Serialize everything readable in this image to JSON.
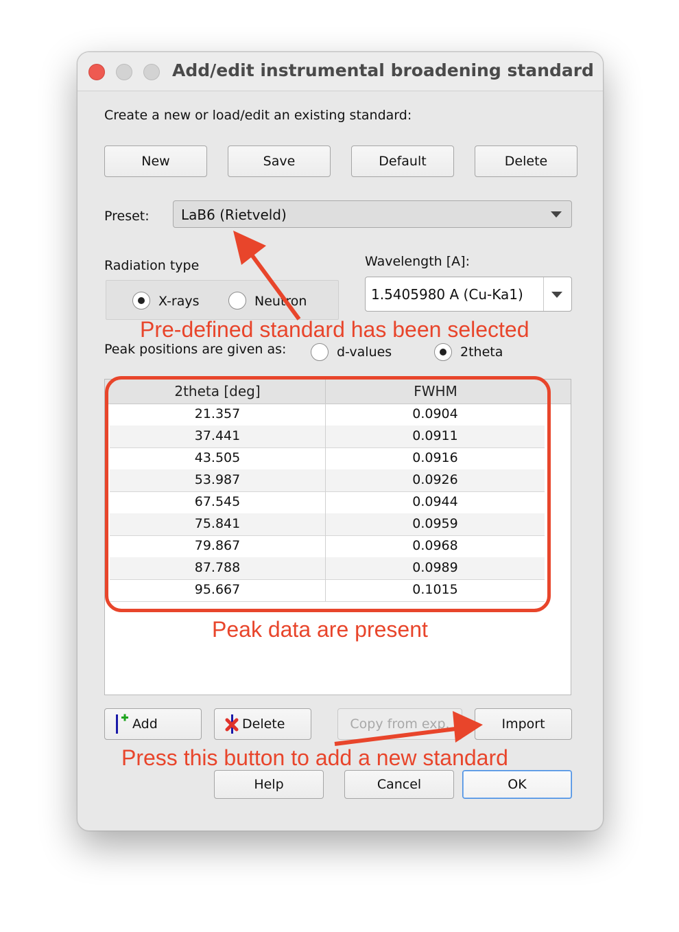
{
  "window": {
    "title": "Add/edit instrumental broadening standard"
  },
  "intro_label": "Create a new or load/edit an existing standard:",
  "top_buttons": {
    "new": "New",
    "save": "Save",
    "default": "Default",
    "delete": "Delete"
  },
  "preset": {
    "label": "Preset:",
    "value": "LaB6 (Rietveld)"
  },
  "radiation": {
    "label": "Radiation type",
    "options": [
      "X-rays",
      "Neutron"
    ],
    "selected": "X-rays"
  },
  "wavelength": {
    "label": "Wavelength [A]:",
    "value": "1.5405980 A (Cu-Ka1)"
  },
  "peak_positions": {
    "label": "Peak positions are given as:",
    "options": [
      "d-values",
      "2theta"
    ],
    "selected": "2theta"
  },
  "table": {
    "columns": [
      "2theta [deg]",
      "FWHM"
    ],
    "rows": [
      [
        "21.357",
        "0.0904"
      ],
      [
        "37.441",
        "0.0911"
      ],
      [
        "43.505",
        "0.0916"
      ],
      [
        "53.987",
        "0.0926"
      ],
      [
        "67.545",
        "0.0944"
      ],
      [
        "75.841",
        "0.0959"
      ],
      [
        "79.867",
        "0.0968"
      ],
      [
        "87.788",
        "0.0989"
      ],
      [
        "95.667",
        "0.1015"
      ]
    ]
  },
  "table_buttons": {
    "add": "Add",
    "delete": "Delete",
    "copy": "Copy from exp.",
    "import": "Import"
  },
  "dialog_buttons": {
    "help": "Help",
    "cancel": "Cancel",
    "ok": "OK"
  },
  "annotations": {
    "preset_note": "Pre-defined standard has been selected",
    "table_note": "Peak data are present",
    "import_note": "Press this button to add a new standard"
  },
  "colors": {
    "annotation": "#e8452b",
    "ok_focus": "#4b8fe2",
    "close_light": "#ee5a51"
  },
  "icons": {
    "add": "add-plus-icon",
    "delete": "delete-x-icon",
    "combo": "chevron-down-icon"
  }
}
